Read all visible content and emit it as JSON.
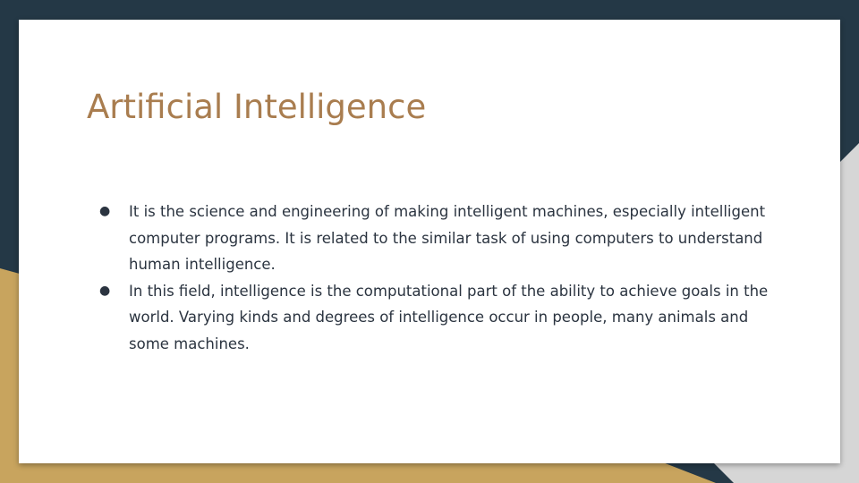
{
  "slide": {
    "title": "Artificial Intelligence",
    "bullets": [
      {
        "marker": "●",
        "text": "It is the science and engineering of making intelligent machines, especially intelligent computer programs. It is related to the similar task of using computers to understand human intelligence."
      },
      {
        "marker": "●",
        "text": "In this field, intelligence is the computational part of the ability to achieve goals in the world. Varying kinds and degrees of intelligence occur in people, many animals and some machines."
      }
    ]
  },
  "colors": {
    "background_dark": "#243846",
    "accent_gold": "#c8a45e",
    "shadow_gray": "#d6d6d6",
    "slide_white": "#ffffff",
    "title_color": "#a97d4f",
    "body_text": "#2b3440"
  }
}
